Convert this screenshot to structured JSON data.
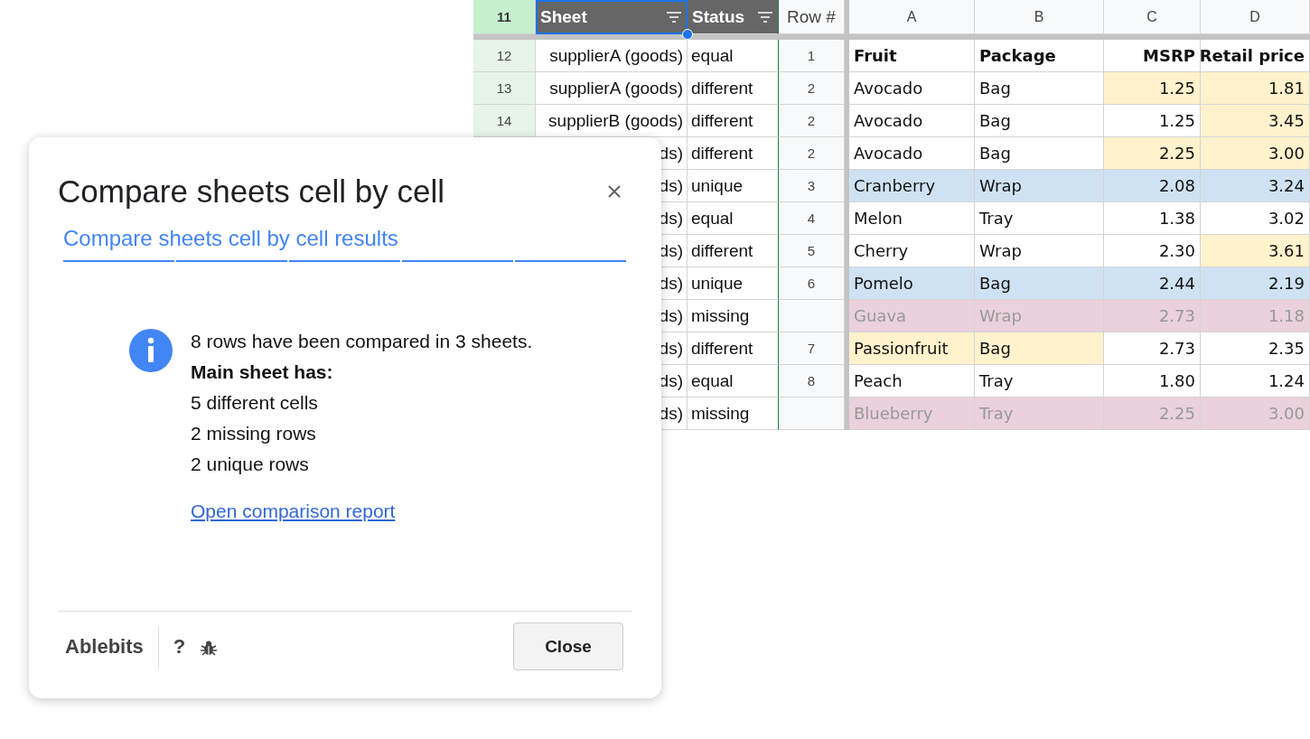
{
  "sheet": {
    "header": {
      "row_number": "11",
      "columns": [
        {
          "label": "Sheet",
          "filter": true,
          "selected": true
        },
        {
          "label": "Status",
          "filter": true,
          "selected": false
        },
        {
          "label": "Row #",
          "filter": false,
          "selected": false
        }
      ],
      "letters": [
        "A",
        "B",
        "C",
        "D"
      ]
    },
    "rows": [
      {
        "row_number": "12",
        "sheet": "supplierA (goods)",
        "status": "equal",
        "row": "1",
        "header": true,
        "cells": [
          {
            "text": "Fruit",
            "kind": "plain"
          },
          {
            "text": "Package",
            "kind": "plain"
          },
          {
            "text": "MSRP",
            "kind": "plain"
          },
          {
            "text": "Retail price",
            "kind": "plain"
          }
        ]
      },
      {
        "row_number": "13",
        "sheet": "supplierA (goods)",
        "status": "different",
        "row": "2",
        "header": false,
        "cells": [
          {
            "text": "Avocado",
            "kind": "plain"
          },
          {
            "text": "Bag",
            "kind": "plain"
          },
          {
            "text": "1.25",
            "kind": "different"
          },
          {
            "text": "1.81",
            "kind": "different"
          }
        ]
      },
      {
        "row_number": "14",
        "sheet": "supplierB (goods)",
        "status": "different",
        "row": "2",
        "header": false,
        "cells": [
          {
            "text": "Avocado",
            "kind": "plain"
          },
          {
            "text": "Bag",
            "kind": "plain"
          },
          {
            "text": "1.25",
            "kind": "plain"
          },
          {
            "text": "3.45",
            "kind": "different"
          }
        ]
      },
      {
        "sheet": "ds)",
        "status": "different",
        "row": "2",
        "header": false,
        "cells": [
          {
            "text": "Avocado",
            "kind": "plain"
          },
          {
            "text": "Bag",
            "kind": "plain"
          },
          {
            "text": "2.25",
            "kind": "different"
          },
          {
            "text": "3.00",
            "kind": "different"
          }
        ]
      },
      {
        "sheet": "ds)",
        "status": "unique",
        "row": "3",
        "header": false,
        "cells": [
          {
            "text": "Cranberry",
            "kind": "unique"
          },
          {
            "text": "Wrap",
            "kind": "unique"
          },
          {
            "text": "2.08",
            "kind": "unique"
          },
          {
            "text": "3.24",
            "kind": "unique"
          }
        ]
      },
      {
        "sheet": "ds)",
        "status": "equal",
        "row": "4",
        "header": false,
        "cells": [
          {
            "text": "Melon",
            "kind": "plain"
          },
          {
            "text": "Tray",
            "kind": "plain"
          },
          {
            "text": "1.38",
            "kind": "plain"
          },
          {
            "text": "3.02",
            "kind": "plain"
          }
        ]
      },
      {
        "sheet": "ds)",
        "status": "different",
        "row": "5",
        "header": false,
        "cells": [
          {
            "text": "Cherry",
            "kind": "plain"
          },
          {
            "text": "Wrap",
            "kind": "plain"
          },
          {
            "text": "2.30",
            "kind": "plain"
          },
          {
            "text": "3.61",
            "kind": "different"
          }
        ]
      },
      {
        "sheet": "ds)",
        "status": "unique",
        "row": "6",
        "header": false,
        "cells": [
          {
            "text": "Pomelo",
            "kind": "unique"
          },
          {
            "text": "Bag",
            "kind": "unique"
          },
          {
            "text": "2.44",
            "kind": "unique"
          },
          {
            "text": "2.19",
            "kind": "unique"
          }
        ]
      },
      {
        "sheet": "ds)",
        "status": "missing",
        "header": false,
        "cells": [
          {
            "text": "Guava",
            "kind": "missing"
          },
          {
            "text": "Wrap",
            "kind": "missing"
          },
          {
            "text": "2.73",
            "kind": "missing"
          },
          {
            "text": "1.18",
            "kind": "missing"
          }
        ]
      },
      {
        "sheet": "ds)",
        "status": "different",
        "row": "7",
        "header": false,
        "cells": [
          {
            "text": "Passionfruit",
            "kind": "different"
          },
          {
            "text": "Bag",
            "kind": "different"
          },
          {
            "text": "2.73",
            "kind": "plain"
          },
          {
            "text": "2.35",
            "kind": "plain"
          }
        ]
      },
      {
        "sheet": "ds)",
        "status": "equal",
        "row": "8",
        "header": false,
        "cells": [
          {
            "text": "Peach",
            "kind": "plain"
          },
          {
            "text": "Tray",
            "kind": "plain"
          },
          {
            "text": "1.80",
            "kind": "plain"
          },
          {
            "text": "1.24",
            "kind": "plain"
          }
        ]
      },
      {
        "sheet": "ds)",
        "status": "missing",
        "header": false,
        "cells": [
          {
            "text": "Blueberry",
            "kind": "missing"
          },
          {
            "text": "Tray",
            "kind": "missing"
          },
          {
            "text": "2.25",
            "kind": "missing"
          },
          {
            "text": "3.00",
            "kind": "missing"
          }
        ]
      }
    ]
  },
  "dialog": {
    "title": "Compare sheets cell by cell",
    "tab": "Compare sheets cell by cell results",
    "lines": [
      {
        "text": "8 rows have been compared in 3 sheets.",
        "kind": "normal"
      },
      {
        "text": "Main sheet has:",
        "kind": "heading"
      },
      {
        "text": "5 different cells",
        "kind": "normal"
      },
      {
        "text": "2 missing rows",
        "kind": "normal"
      },
      {
        "text": "2 unique rows",
        "kind": "normal"
      }
    ],
    "link": "Open comparison report",
    "brand": "Ablebits",
    "help": "?",
    "button": "Close"
  }
}
